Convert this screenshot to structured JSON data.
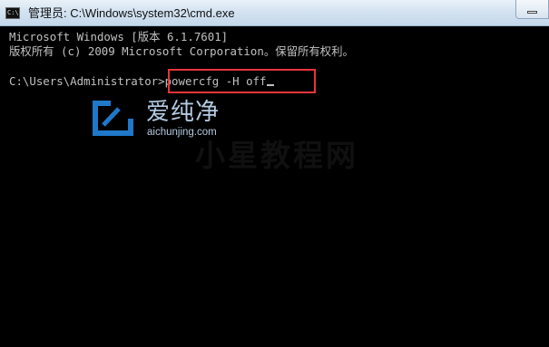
{
  "window": {
    "title": "管理员: C:\\Windows\\system32\\cmd.exe",
    "icon_glyph": "C:\\"
  },
  "console": {
    "lines": [
      "Microsoft Windows [版本 6.1.7601]",
      "版权所有 (c) 2009 Microsoft Corporation。保留所有权利。"
    ],
    "prompt": "C:\\Users\\Administrator>",
    "command": "powercfg -H off"
  },
  "watermark": {
    "brand_cn": "爱纯净",
    "brand_url": "aichunjing.com",
    "overlay_text": "小星教程网"
  },
  "colors": {
    "console_background": "#000000",
    "console_text": "#c0c0c0",
    "highlight_box": "#e8343a",
    "watermark": "#b4cbe2"
  },
  "icons": {
    "app": "cmd-console-icon",
    "minimize": "minimize-icon",
    "watermark_logo": "aichunjing-logo-icon"
  }
}
